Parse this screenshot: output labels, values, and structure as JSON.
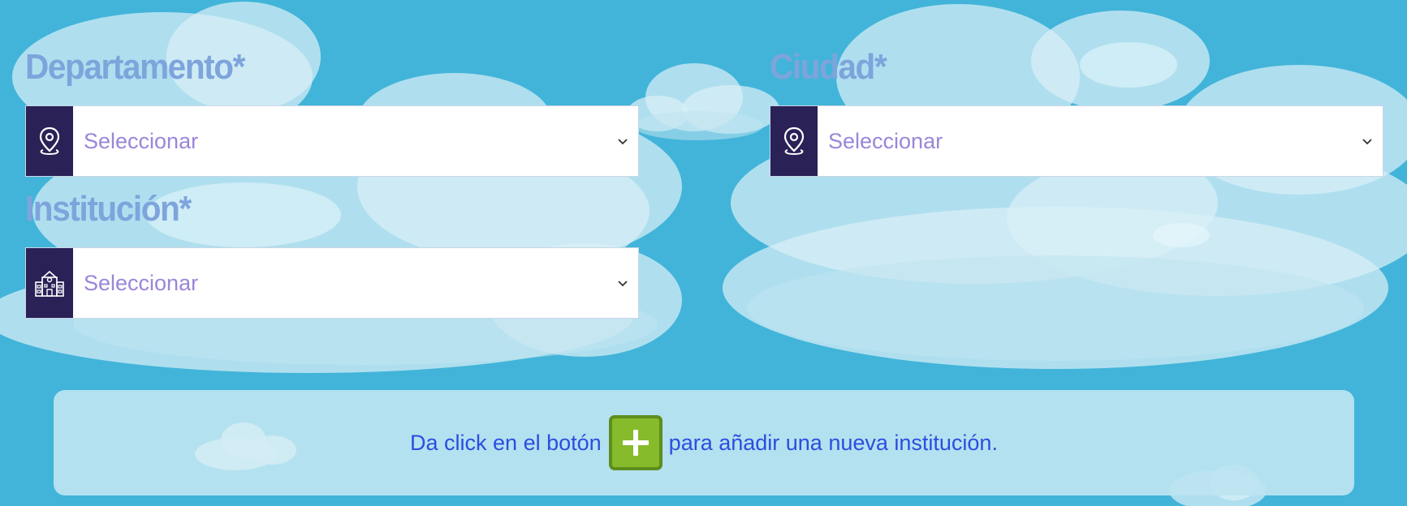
{
  "fields": {
    "departamento": {
      "label": "Departamento*",
      "value": "Seleccionar",
      "icon": "map-pin-icon"
    },
    "ciudad": {
      "label": "Ciudad*",
      "value": "Seleccionar",
      "icon": "map-pin-icon"
    },
    "institucion": {
      "label": "Institución*",
      "value": "Seleccionar",
      "icon": "school-building-icon"
    }
  },
  "info": {
    "text_before": "Da click en el botón",
    "text_after": "para añadir una nueva institución.",
    "button_icon": "plus-icon"
  },
  "colors": {
    "background": "#42b4d9",
    "icon_panel": "#2a2157",
    "label": "#7ea4dc",
    "placeholder": "#9b86d8",
    "info_text": "#2c4de0",
    "add_button": "#86bc2c"
  }
}
